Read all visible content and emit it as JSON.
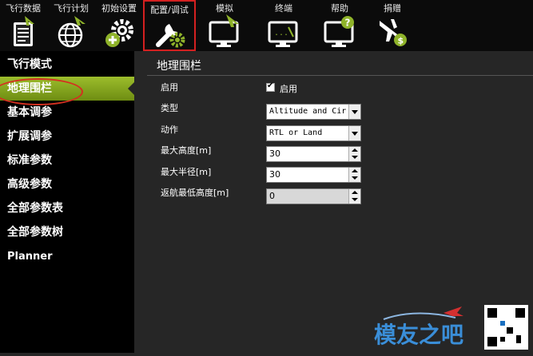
{
  "toolbar": {
    "items": [
      {
        "label": "飞行数据",
        "icon": "flight-data-icon"
      },
      {
        "label": "飞行计划",
        "icon": "flight-plan-globe-icon"
      },
      {
        "label": "初始设置",
        "icon": "initial-setup-gear-icon"
      },
      {
        "label": "配置/调试",
        "icon": "config-tuning-wrench-icon"
      },
      {
        "label": "模拟",
        "icon": "simulation-monitor-icon"
      },
      {
        "label": "终端",
        "icon": "terminal-monitor-icon"
      },
      {
        "label": "帮助",
        "icon": "help-monitor-icon"
      },
      {
        "label": "捐赠",
        "icon": "donate-plane-icon"
      }
    ],
    "active_index": 3
  },
  "sidebar": {
    "items": [
      {
        "label": "飞行模式"
      },
      {
        "label": "地理围栏"
      },
      {
        "label": "基本调参"
      },
      {
        "label": "扩展调参"
      },
      {
        "label": "标准参数"
      },
      {
        "label": "高级参数"
      },
      {
        "label": "全部参数表"
      },
      {
        "label": "全部参数树"
      },
      {
        "label": "Planner"
      }
    ],
    "selected_index": 1
  },
  "panel": {
    "title": "地理围栏",
    "enable_label": "启用",
    "enable_checkbox_label": "启用",
    "enable_checked": true,
    "type_label": "类型",
    "type_value": "Altitude and Cir",
    "action_label": "动作",
    "action_value": "RTL or Land",
    "max_alt_label": "最大高度[m]",
    "max_alt_value": "30",
    "max_radius_label": "最大半径[m]",
    "max_radius_value": "30",
    "rtl_min_alt_label": "返航最低高度[m]",
    "rtl_min_alt_value": "0"
  },
  "watermark": {
    "text": "模友之吧"
  },
  "colors": {
    "selected_green": "#86a41e",
    "annotation_red": "#d42020"
  }
}
